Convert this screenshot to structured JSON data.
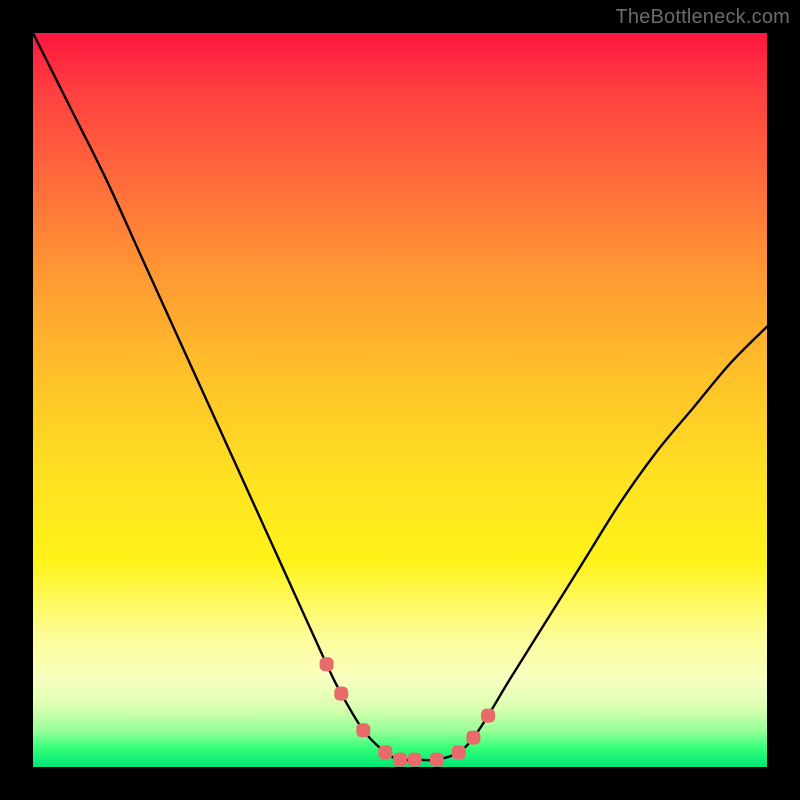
{
  "watermark": "TheBottleneck.com",
  "chart_data": {
    "type": "line",
    "title": "",
    "xlabel": "",
    "ylabel": "",
    "xlim": [
      0,
      100
    ],
    "ylim": [
      0,
      100
    ],
    "series": [
      {
        "name": "bottleneck-curve",
        "x": [
          0,
          5,
          10,
          15,
          20,
          25,
          30,
          35,
          40,
          42,
          45,
          48,
          50,
          52,
          55,
          58,
          60,
          62,
          65,
          70,
          75,
          80,
          85,
          90,
          95,
          100
        ],
        "values": [
          100,
          90,
          80,
          69,
          58,
          47,
          36,
          25,
          14,
          10,
          5,
          2,
          1,
          1,
          1,
          2,
          4,
          7,
          12,
          20,
          28,
          36,
          43,
          49,
          55,
          60
        ]
      }
    ],
    "markers": {
      "name": "highlight-dots",
      "x": [
        40,
        42,
        45,
        48,
        50,
        52,
        55,
        58,
        60,
        62
      ],
      "values": [
        14,
        10,
        5,
        2,
        1,
        1,
        1,
        2,
        4,
        7
      ],
      "color": "#e86a6a"
    },
    "gradient_stops": [
      {
        "pos": 0,
        "color": "#ff153f"
      },
      {
        "pos": 0.33,
        "color": "#ff9933"
      },
      {
        "pos": 0.72,
        "color": "#fff31a"
      },
      {
        "pos": 1.0,
        "color": "#00e676"
      }
    ]
  }
}
